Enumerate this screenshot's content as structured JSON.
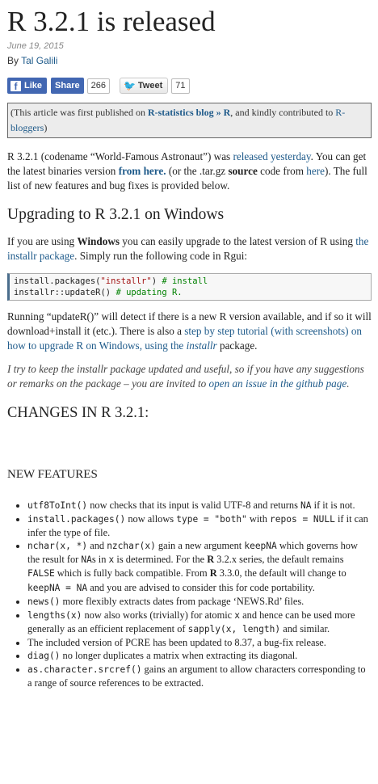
{
  "article": {
    "title": "R 3.2.1 is released",
    "date": "June 19, 2015",
    "by": "By ",
    "author": "Tal Galili"
  },
  "social": {
    "like_label": "Like",
    "share_label": "Share",
    "share_count": "266",
    "tweet_label": "Tweet",
    "tweet_count": "71"
  },
  "notice": {
    "prefix": "(This article was first published on ",
    "blog_link": "R-statistics blog » R",
    "middle": ", and kindly contributed to ",
    "rb_link": "R-bloggers",
    "suffix": ")"
  },
  "intro": {
    "t1": "R 3.2.1 (codename “World-Famous Astronaut”) was ",
    "released_link": "released yesterday",
    "t2": ". You can get the latest binaries version ",
    "from_here": "from here.",
    "t3": " (or the .tar.gz ",
    "source": "source",
    "t4": " code from ",
    "here": "here",
    "t5": "). The full list of new features and bug fixes is provided below."
  },
  "upgrading": {
    "heading": "Upgrading to R 3.2.1 on Windows",
    "t1": "If you are using ",
    "windows": "Windows",
    "t2": " you can easily upgrade to the latest version of R using ",
    "installr_link": "the installr package",
    "t3": ". Simply run the following code in Rgui:"
  },
  "code": {
    "l1_fn": "install.packages(",
    "l1_str": "\"installr\"",
    "l1_close": ") ",
    "l1_comment": "# install",
    "l2_fn": "installr::updateR() ",
    "l2_comment": "# updating R."
  },
  "running": {
    "t1": "Running “updateR()” will detect if there is a new R version available, and if so it will download+install it (etc.). There is also a ",
    "link1": "step by step tutorial (with screenshots) on how to upgrade R on Windows, using the ",
    "link_italic": "installr",
    "t2": " package."
  },
  "try": {
    "t1": "I try to keep the installr package updated and useful, so if you have any suggestions or remarks on the package – you are invited to ",
    "link": "open an issue in the github page",
    "t2": "."
  },
  "changes_heading": "CHANGES IN R 3.2.1:",
  "new_features_heading": "NEW FEATURES",
  "features": [
    {
      "code1": "utf8ToInt()",
      "t1": " now checks that its input is valid UTF-8 and returns ",
      "code2": "NA",
      "t2": " if it is not."
    },
    {
      "code1": "install.packages()",
      "t1": " now allows ",
      "code2": "type = \"both\"",
      "t2": " with ",
      "code3": "repos = NULL",
      "t3": " if it can infer the type of file."
    },
    {
      "code1": "nchar(x, *)",
      "t1": " and ",
      "code2": "nzchar(x)",
      "t2": " gain a new argument ",
      "code3": "keepNA",
      "t3": " which governs how the result for ",
      "code4": "NA",
      "t4": "s in ",
      "code5": "x",
      "t5": " is determined. For the ",
      "bold1": "R",
      "t6": " 3.2.x series, the default remains ",
      "code6": "FALSE",
      "t7": " which is fully back compatible. From ",
      "bold2": "R",
      "t8": " 3.3.0, the default will change to ",
      "code7": "keepNA = NA",
      "t9": " and you are advised to consider this for code portability."
    },
    {
      "code1": "news()",
      "t1": " more flexibly extracts dates from package ‘NEWS.Rd’ files."
    },
    {
      "code1": "lengths(x)",
      "t1": " now also works (trivially) for atomic ",
      "code2": "x",
      "t2": " and hence can be used more generally as an efficient replacement of ",
      "code3": "sapply(x, length)",
      "t3": " and similar."
    },
    {
      "t1": "The included version of PCRE has been updated to 8.37, a bug-fix release."
    },
    {
      "code1": "diag()",
      "t1": " no longer duplicates a matrix when extracting its diagonal."
    },
    {
      "code1": "as.character.srcref()",
      "t1": " gains an argument to allow characters corresponding to a range of source references to be extracted."
    }
  ]
}
